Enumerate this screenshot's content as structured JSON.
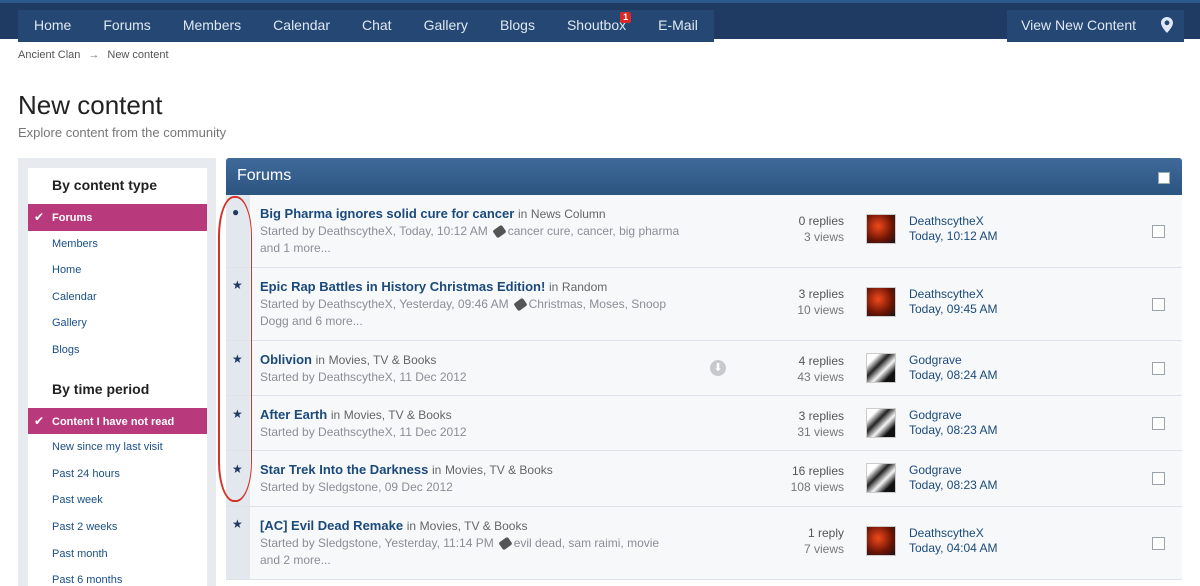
{
  "nav": {
    "items": [
      {
        "label": "Home"
      },
      {
        "label": "Forums"
      },
      {
        "label": "Members"
      },
      {
        "label": "Calendar"
      },
      {
        "label": "Chat"
      },
      {
        "label": "Gallery"
      },
      {
        "label": "Blogs"
      },
      {
        "label": "Shoutbox",
        "badge": "1"
      },
      {
        "label": "E-Mail"
      }
    ],
    "view_new_content": "View New Content"
  },
  "breadcrumb": {
    "root": "Ancient Clan",
    "sep": "→",
    "current": "New content"
  },
  "page": {
    "title": "New content",
    "subtitle": "Explore content from the community"
  },
  "sidebar": {
    "content_type_heading": "By content type",
    "content_type_items": [
      {
        "label": "Forums",
        "active": true
      },
      {
        "label": "Members"
      },
      {
        "label": "Home"
      },
      {
        "label": "Calendar"
      },
      {
        "label": "Gallery"
      },
      {
        "label": "Blogs"
      }
    ],
    "time_heading": "By time period",
    "time_items": [
      {
        "label": "Content I have not read",
        "active": true
      },
      {
        "label": "New since my last visit"
      },
      {
        "label": "Past 24 hours"
      },
      {
        "label": "Past week"
      },
      {
        "label": "Past 2 weeks"
      },
      {
        "label": "Past month"
      },
      {
        "label": "Past 6 months"
      }
    ]
  },
  "main": {
    "title": "Forums",
    "topics": [
      {
        "title": "Big Pharma ignores solid cure for cancer",
        "in_label": "in",
        "forum": "News Column",
        "started": "Started by DeathscytheX, Today, 10:12 AM",
        "tags": "cancer cure, cancer, big pharma",
        "more": "and 1 more...",
        "replies": "0 replies",
        "views": "3 views",
        "last_user": "DeathscytheX",
        "last_time": "Today, 10:12 AM",
        "avatar": "red",
        "marker": "●"
      },
      {
        "title": "Epic Rap Battles in History Christmas Edition!",
        "in_label": "in",
        "forum": "Random",
        "started": "Started by DeathscytheX, Yesterday, 09:46 AM",
        "tags": "Christmas, Moses, Snoop",
        "more": "Dogg and 6 more...",
        "replies": "3 replies",
        "views": "10 views",
        "last_user": "DeathscytheX",
        "last_time": "Today, 09:45 AM",
        "avatar": "red",
        "marker": "★"
      },
      {
        "title": "Oblivion",
        "in_label": "in",
        "forum": "Movies, TV & Books",
        "started": "Started by DeathscytheX, 11 Dec 2012",
        "tags": "",
        "more": "",
        "replies": "4 replies",
        "views": "43 views",
        "last_user": "Godgrave",
        "last_time": "Today, 08:24 AM",
        "avatar": "dark",
        "marker": "★"
      },
      {
        "title": "After Earth",
        "in_label": "in",
        "forum": "Movies, TV & Books",
        "started": "Started by DeathscytheX, 11 Dec 2012",
        "tags": "",
        "more": "",
        "replies": "3 replies",
        "views": "31 views",
        "last_user": "Godgrave",
        "last_time": "Today, 08:23 AM",
        "avatar": "dark",
        "marker": "★"
      },
      {
        "title": "Star Trek Into the Darkness",
        "in_label": "in",
        "forum": "Movies, TV & Books",
        "started": "Started by Sledgstone, 09 Dec 2012",
        "tags": "",
        "more": "",
        "replies": "16 replies",
        "views": "108 views",
        "last_user": "Godgrave",
        "last_time": "Today, 08:23 AM",
        "avatar": "dark",
        "marker": "★"
      },
      {
        "title": "[AC] Evil Dead Remake",
        "in_label": "in",
        "forum": "Movies, TV & Books",
        "started": "Started by Sledgstone, Yesterday, 11:14 PM",
        "tags": "evil dead, sam raimi, movie",
        "more": "and 2 more...",
        "replies": "1 reply",
        "views": "7 views",
        "last_user": "DeathscytheX",
        "last_time": "Today, 04:04 AM",
        "avatar": "red",
        "marker": "★"
      }
    ]
  }
}
